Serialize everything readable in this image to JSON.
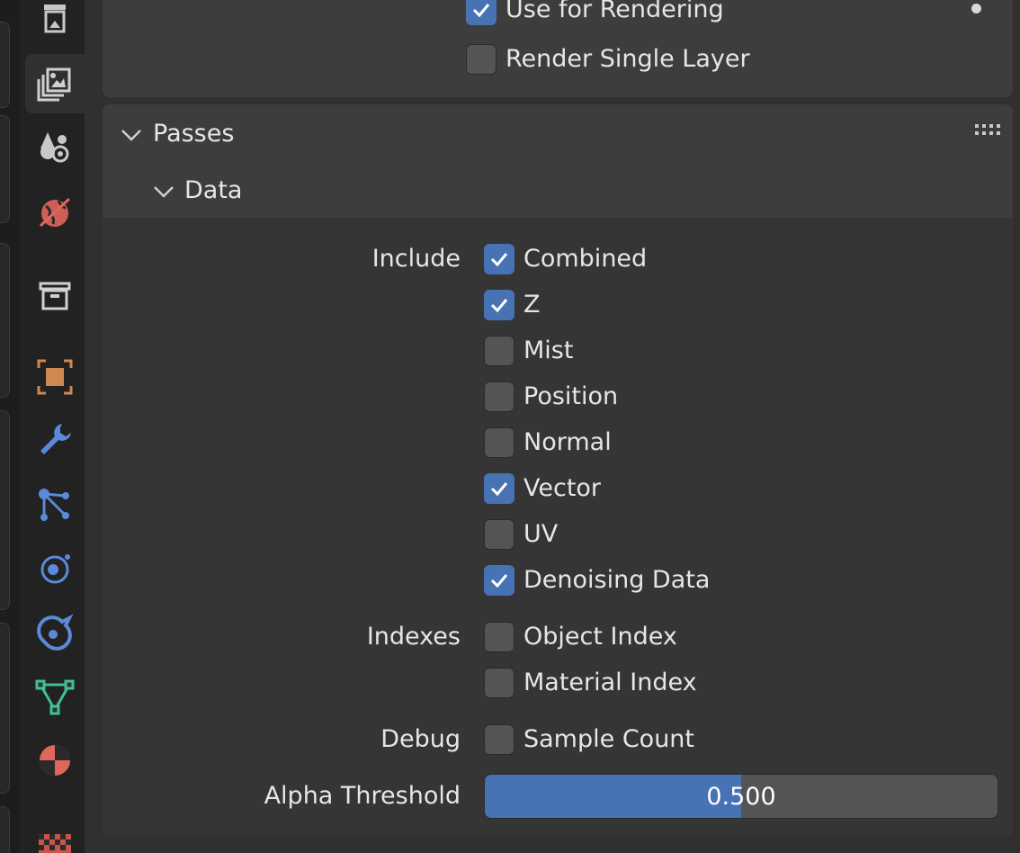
{
  "toolbar": {
    "icons": [
      {
        "name": "output-properties-icon",
        "active": false
      },
      {
        "name": "view-layer-properties-icon",
        "active": true
      },
      {
        "name": "scene-properties-icon",
        "active": false
      },
      {
        "name": "world-properties-icon",
        "active": false
      },
      {
        "name": "collection-properties-icon",
        "active": false
      },
      {
        "name": "object-properties-icon",
        "active": false
      },
      {
        "name": "modifier-properties-icon",
        "active": false
      },
      {
        "name": "particles-properties-icon",
        "active": false
      },
      {
        "name": "physics-properties-icon",
        "active": false
      },
      {
        "name": "constraints-properties-icon",
        "active": false
      },
      {
        "name": "object-data-properties-icon",
        "active": false
      },
      {
        "name": "material-properties-icon",
        "active": false
      },
      {
        "name": "texture-properties-icon",
        "active": false
      }
    ]
  },
  "view_layer": {
    "use_for_rendering": {
      "label": "Use for Rendering",
      "checked": true
    },
    "render_single_layer": {
      "label": "Render Single Layer",
      "checked": false
    }
  },
  "passes": {
    "title": "Passes",
    "data": {
      "title": "Data",
      "include_label": "Include",
      "include": [
        {
          "label": "Combined",
          "checked": true
        },
        {
          "label": "Z",
          "checked": true
        },
        {
          "label": "Mist",
          "checked": false
        },
        {
          "label": "Position",
          "checked": false
        },
        {
          "label": "Normal",
          "checked": false
        },
        {
          "label": "Vector",
          "checked": true
        },
        {
          "label": "UV",
          "checked": false
        },
        {
          "label": "Denoising Data",
          "checked": true
        }
      ],
      "indexes_label": "Indexes",
      "indexes": [
        {
          "label": "Object Index",
          "checked": false
        },
        {
          "label": "Material Index",
          "checked": false
        }
      ],
      "debug_label": "Debug",
      "debug": [
        {
          "label": "Sample Count",
          "checked": false
        }
      ],
      "alpha_threshold": {
        "label": "Alpha Threshold",
        "value": "0.500",
        "fraction": 0.5
      }
    }
  },
  "colors": {
    "accent": "#4772b3",
    "panel": "#3d3d3d",
    "background": "#303030"
  }
}
